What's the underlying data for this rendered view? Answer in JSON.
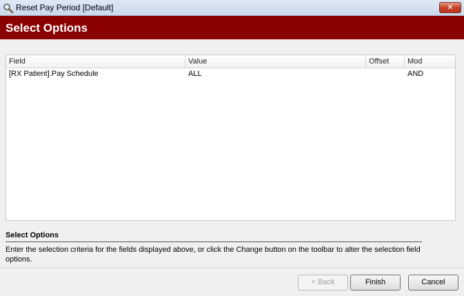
{
  "window": {
    "title": "Reset Pay Period [Default]",
    "close_label": "✕"
  },
  "header": {
    "title": "Select Options"
  },
  "grid": {
    "columns": [
      "Field",
      "Value",
      "Offset",
      "Mod"
    ],
    "rows": [
      {
        "field": "[RX Patient].Pay Schedule",
        "value": "ALL",
        "offset": "",
        "mod": "AND"
      }
    ]
  },
  "help": {
    "title": "Select Options",
    "description": "Enter the selection criteria for the fields displayed above, or click the Change button on the toolbar to alter the selection field options."
  },
  "buttons": {
    "back": "< Back",
    "finish": "Finish",
    "cancel": "Cancel"
  },
  "colors": {
    "header_band": "#8b0000",
    "close_button": "#c8432b"
  },
  "icons": {
    "window_icon": "magnifier-icon"
  }
}
